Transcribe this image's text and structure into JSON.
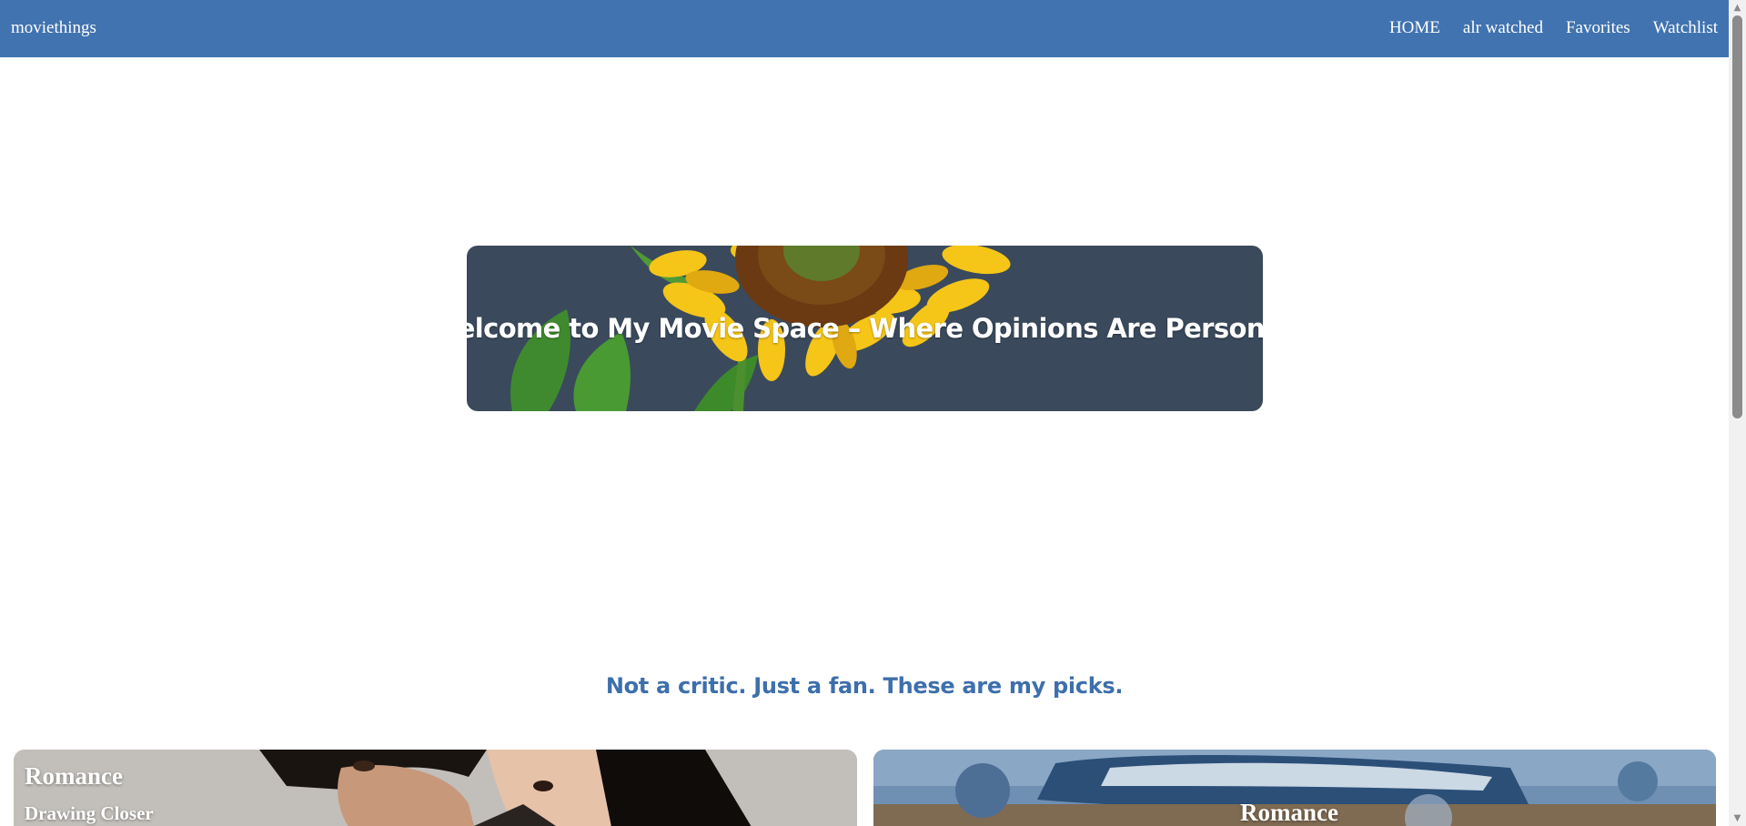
{
  "navbar": {
    "brand": "moviethings",
    "links": [
      "HOME",
      "alr watched",
      "Favorites",
      "Watchlist"
    ],
    "color": "#4173b0"
  },
  "hero": {
    "title": "Welcome to My Movie Space – Where Opinions Are Personal."
  },
  "tagline": "Not a critic. Just a fan. These are my picks.",
  "cards": [
    {
      "genre": "Romance",
      "title": "Drawing Closer"
    },
    {
      "genre": "Romance"
    }
  ],
  "icons": {
    "scroll_up": "triangle-up-icon",
    "scroll_down": "triangle-down-icon"
  }
}
